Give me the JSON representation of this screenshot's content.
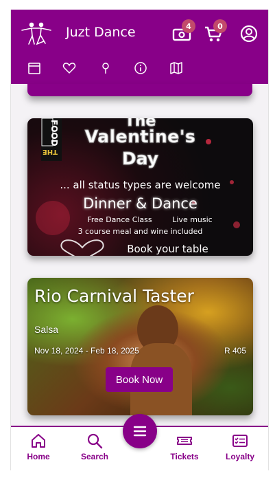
{
  "app": {
    "title": "Juzt Dance"
  },
  "header": {
    "tickets_badge": "4",
    "cart_badge": "0",
    "icons": [
      "dancers-logo-icon",
      "ticket-icon",
      "cart-icon",
      "account-icon"
    ]
  },
  "subnav": {
    "icons": [
      "calendar-icon",
      "heart-icon",
      "map-pin-icon",
      "info-icon",
      "map-icon"
    ]
  },
  "events": [
    {
      "poster_text": {
        "brand": "THE FOOD",
        "line1": "The",
        "line2": "Valentine's",
        "line3": "Day",
        "line4": "... all  status types are welcome",
        "line5": "Dinner & Dance",
        "line6a": "Free Dance Class",
        "line6b": "Live music",
        "line7": "3 course meal and wine included",
        "line8": "Book your table"
      }
    },
    {
      "title": "Rio Carnival Taster",
      "category": "Salsa",
      "dates": "Nov 18, 2024 - Feb 18, 2025",
      "price": "R 405",
      "button_label": "Book Now"
    }
  ],
  "bottom_nav": {
    "items": [
      {
        "label": "Home",
        "icon": "home-icon"
      },
      {
        "label": "Search",
        "icon": "search-icon"
      },
      {
        "label": "Tickets",
        "icon": "ticket-icon"
      },
      {
        "label": "Loyalty",
        "icon": "loyalty-card-icon"
      }
    ],
    "fab_icon": "menu-icon"
  },
  "colors": {
    "brand": "#880088",
    "badge": "#c24a6b"
  }
}
